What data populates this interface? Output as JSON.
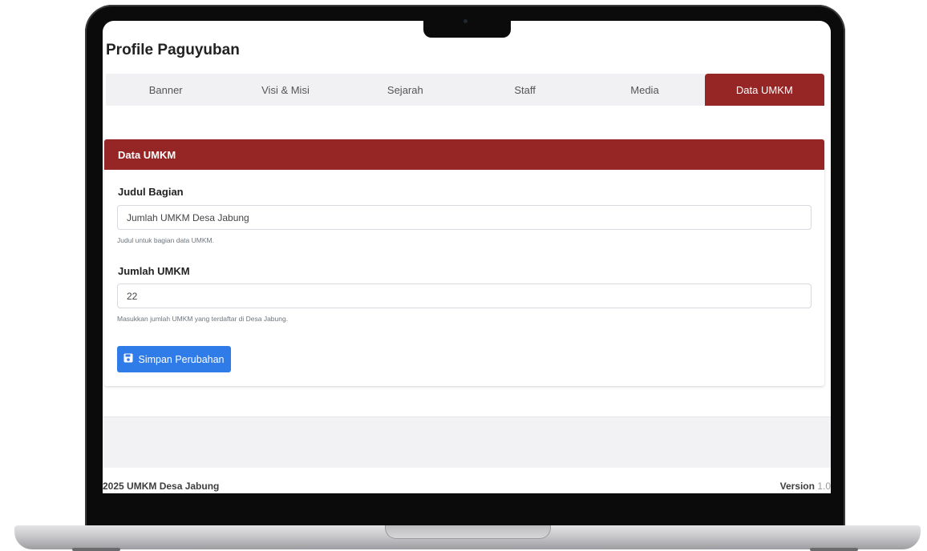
{
  "page": {
    "title": "Profile Paguyuban"
  },
  "tabs": [
    {
      "label": "Banner",
      "active": false
    },
    {
      "label": "Visi & Misi",
      "active": false
    },
    {
      "label": "Sejarah",
      "active": false
    },
    {
      "label": "Staff",
      "active": false
    },
    {
      "label": "Media",
      "active": false
    },
    {
      "label": "Data UMKM",
      "active": true
    }
  ],
  "card": {
    "header": "Data UMKM",
    "fields": {
      "judul": {
        "label": "Judul Bagian",
        "value": "Jumlah UMKM Desa Jabung",
        "help": "Judul untuk bagian data UMKM."
      },
      "jumlah": {
        "label": "Jumlah UMKM",
        "value": "22",
        "help": "Masukkan jumlah UMKM yang terdaftar di Desa Jabung."
      }
    },
    "save_button": {
      "label": "Simpan Perubahan",
      "icon": "save-icon"
    }
  },
  "footer": {
    "copyright": "2025 UMKM Desa Jabung",
    "version_label": "Version",
    "version_number": "1.0"
  },
  "colors": {
    "accent": "#962525",
    "primary_button": "#2f7be8"
  }
}
